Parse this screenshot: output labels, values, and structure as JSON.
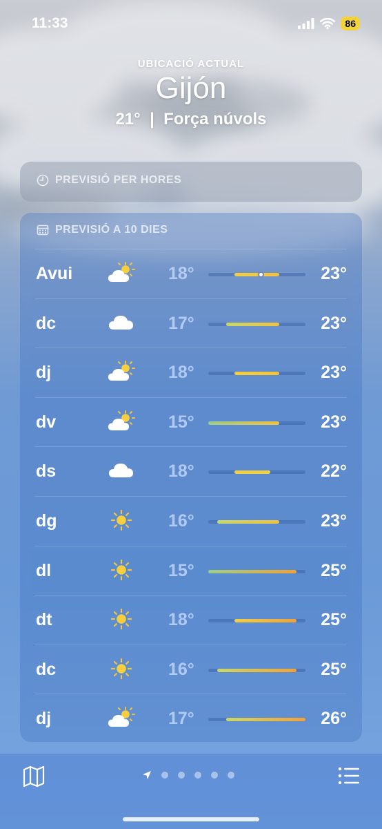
{
  "status": {
    "time": "11:33",
    "battery": "86",
    "icons": [
      "signal-icon",
      "wifi-icon"
    ]
  },
  "header": {
    "location_label": "UBICACIÓ ACTUAL",
    "city": "Gijón",
    "temperature": "21°",
    "separator": "|",
    "condition": "Força núvols"
  },
  "hourly": {
    "title": "PREVISIÓ PER HORES",
    "icon": "clock-icon"
  },
  "daily": {
    "title": "PREVISIÓ A 10 DIES",
    "icon": "calendar-icon",
    "range_min": 15,
    "range_max": 26,
    "current_temp": 21,
    "days": [
      {
        "day": "Avui",
        "icon": "partly-cloudy-icon",
        "low": "18°",
        "high": "23°",
        "lo": 18,
        "hi": 23
      },
      {
        "day": "dc",
        "icon": "cloud-icon",
        "low": "17°",
        "high": "23°",
        "lo": 17,
        "hi": 23
      },
      {
        "day": "dj",
        "icon": "partly-cloudy-icon",
        "low": "18°",
        "high": "23°",
        "lo": 18,
        "hi": 23
      },
      {
        "day": "dv",
        "icon": "partly-cloudy-icon",
        "low": "15°",
        "high": "23°",
        "lo": 15,
        "hi": 23
      },
      {
        "day": "ds",
        "icon": "cloud-icon",
        "low": "18°",
        "high": "22°",
        "lo": 18,
        "hi": 22
      },
      {
        "day": "dg",
        "icon": "sun-icon",
        "low": "16°",
        "high": "23°",
        "lo": 16,
        "hi": 23
      },
      {
        "day": "dl",
        "icon": "sun-icon",
        "low": "15°",
        "high": "25°",
        "lo": 15,
        "hi": 25
      },
      {
        "day": "dt",
        "icon": "sun-icon",
        "low": "18°",
        "high": "25°",
        "lo": 18,
        "hi": 25
      },
      {
        "day": "dc",
        "icon": "sun-icon",
        "low": "16°",
        "high": "25°",
        "lo": 16,
        "hi": 25
      },
      {
        "day": "dj",
        "icon": "partly-cloudy-icon",
        "low": "17°",
        "high": "26°",
        "lo": 17,
        "hi": 26
      }
    ]
  },
  "toolbar": {
    "map_icon": "map-icon",
    "list_icon": "list-icon",
    "location_icon": "location-arrow-icon",
    "page_count": 5
  }
}
